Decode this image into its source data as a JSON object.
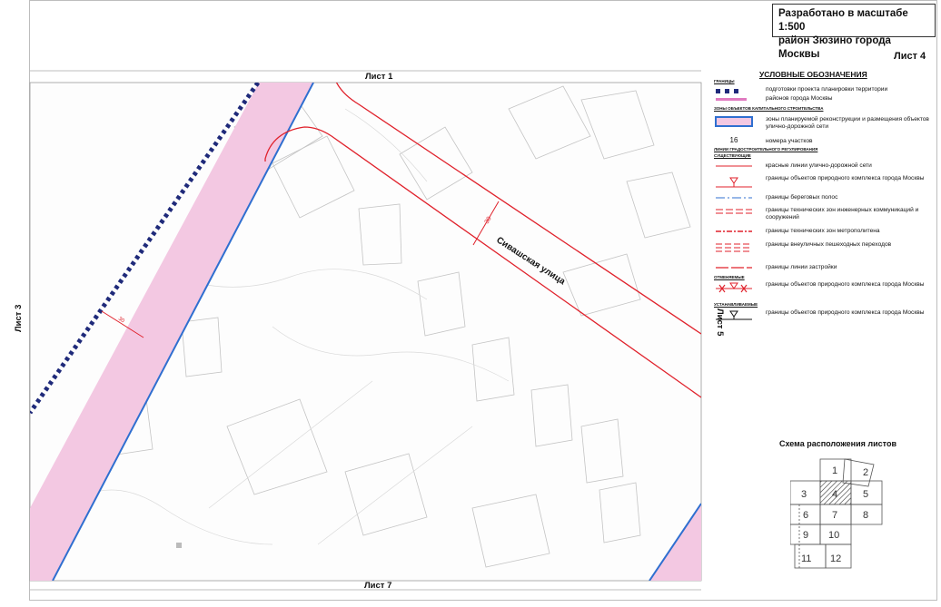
{
  "title_box": {
    "line1": "Разработано в масштабе 1:500",
    "line2": "район Зюзино города Москвы"
  },
  "sheet_label": "Лист 4",
  "adjacent_sheets": {
    "top": "Лист 1",
    "bottom": "Лист 7",
    "left": "Лист 3",
    "right": "Лист 5"
  },
  "street_label": "Сивашская улица",
  "dimension_labels": [
    "30",
    "30"
  ],
  "legend": {
    "title": "УСЛОВНЫЕ ОБОЗНАЧЕНИЯ",
    "sections": [
      {
        "heading": "границы",
        "items": [
          {
            "symbol": "dots-blue-icon",
            "text": "подготовки проекта планировки территории"
          },
          {
            "symbol": "magenta-band-icon",
            "text": "районов города Москвы"
          }
        ]
      },
      {
        "heading": "зоны объектов капитального строительства",
        "items": [
          {
            "symbol": "pink-zone-icon",
            "text": "зоны планируемой реконструкции и размещения объектов улично-дорожной сети"
          },
          {
            "symbol": "number-16",
            "symbol_text": "16",
            "text": "номера участков"
          }
        ]
      },
      {
        "heading": "линии градостроительного регулирования",
        "subheading": "существующие",
        "items": [
          {
            "symbol": "red-line-icon",
            "text": "красные линии улично-дорожной сети"
          },
          {
            "symbol": "red-triangle-line-icon",
            "text": "границы объектов природного комплекса города Москвы"
          },
          {
            "symbol": "blue-dash-line-icon",
            "text": "границы береговых полос"
          },
          {
            "symbol": "red-double-dash-icon",
            "text": "границы технических зон инженерных коммуникаций и сооружений"
          },
          {
            "symbol": "red-dash-line-icon",
            "text": "границы технических зон метрополитена"
          },
          {
            "symbol": "red-triple-dash-icon",
            "text": "границы внеуличных пешеходных переходов"
          },
          {
            "symbol": "red-long-dash-icon",
            "text": "границы линии застройки"
          }
        ]
      },
      {
        "heading": "отменяемые",
        "items": [
          {
            "symbol": "red-cross-line-icon",
            "text": "границы объектов природного комплекса города Москвы"
          }
        ]
      },
      {
        "heading": "устанавливаемые",
        "items": [
          {
            "symbol": "black-triangle-line-icon",
            "text": "границы объектов природного комплекса города Москвы"
          }
        ]
      }
    ]
  },
  "scheme": {
    "title": "Схема расположения листов",
    "cells": [
      "1",
      "2",
      "3",
      "4",
      "5",
      "6",
      "7",
      "8",
      "9",
      "10",
      "11",
      "12"
    ],
    "current": "4"
  },
  "colors": {
    "red_line": "#e0212b",
    "zone_fill": "#f3c8e2",
    "boundary_blue": "#1f2a7a",
    "shoreline_blue": "#2f6fd0",
    "building_outline": "#c4c4c4"
  }
}
